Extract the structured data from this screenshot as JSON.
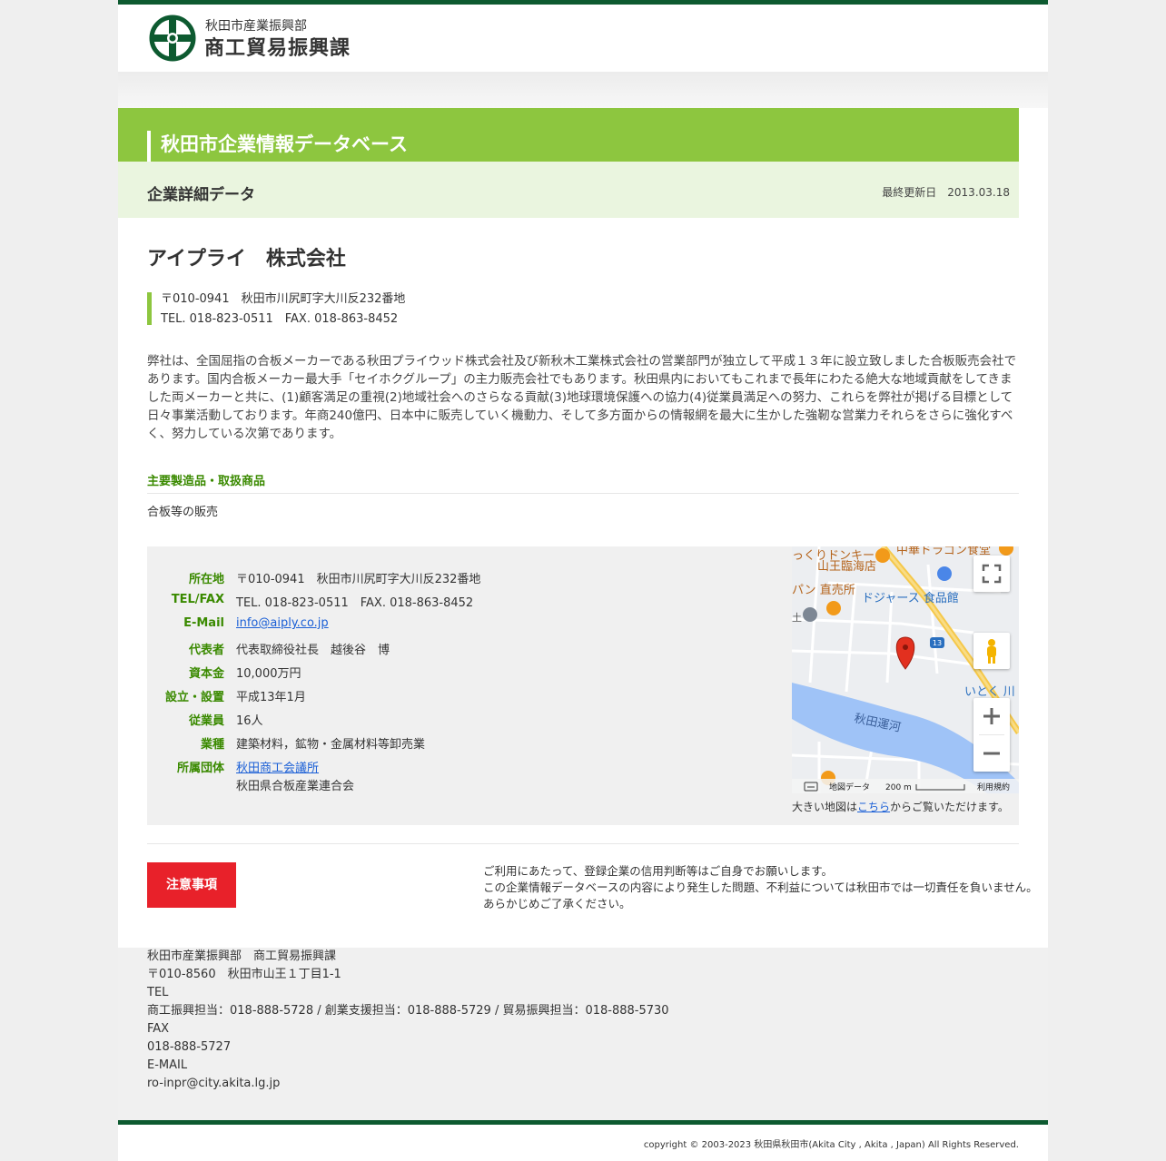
{
  "header": {
    "dept": "秋田市産業振興部",
    "section": "商工貿易振興課"
  },
  "db_title": "秋田市企業情報データベース",
  "subhead": {
    "title": "企業詳細データ",
    "updated_label": "最終更新日",
    "updated_date": "2013.03.18"
  },
  "company": {
    "name": "アイプライ　株式会社",
    "address": "〒010-0941　秋田市川尻町字大川反232番地",
    "telfax": "TEL. 018-823-0511　FAX. 018-863-8452",
    "description": "弊社は、全国屈指の合板メーカーである秋田プライウッド株式会社及び新秋木工業株式会社の営業部門が独立して平成１３年に設立致しました合板販売会社であります。国内合板メーカー最大手「セイホクグループ」の主力販売会社でもあります。秋田県内においてもこれまで長年にわたる絶大な地域貢献をしてきました両メーカーと共に、(1)顧客満足の重視(2)地域社会へのさらなる貢献(3)地球環境保護への協力(4)従業員満足への努力、これらを弊社が掲げる目標として日々事業活動しております。年商240億円、日本中に販売していく機動力、そして多方面からの情報網を最大に生かした強靭な営業力それらをさらに強化すべく、努力している次第であります。"
  },
  "products": {
    "heading": "主要製造品・取扱商品",
    "value": "合板等の販売"
  },
  "info": [
    {
      "label": "所在地",
      "value": "〒010-0941　秋田市川尻町字大川反232番地"
    },
    {
      "label": "TEL/FAX",
      "value": "TEL. 018-823-0511　FAX. 018-863-8452"
    },
    {
      "label": "E-Mail",
      "value": "info@aiply.co.jp"
    },
    {
      "label": "代表者",
      "value": "代表取締役社長　越後谷　博"
    },
    {
      "label": "資本金",
      "value": "10,000万円"
    },
    {
      "label": "設立・設置",
      "value": "平成13年1月"
    },
    {
      "label": "従業員",
      "value": "16人"
    },
    {
      "label": "業種",
      "value": "建築材料，鉱物・金属材料等卸売業"
    },
    {
      "label": "所属団体",
      "value": "秋田商工会議所",
      "value2": "秋田県合板産業連合会"
    }
  ],
  "map": {
    "labels": {
      "donkey": "っくりドンキー",
      "sanno": "山王臨海店",
      "dragon": "中華ドラゴン食堂",
      "pan": "パン 直売所",
      "dodgers": "ドジャース 食品館",
      "itoku": "いとく 川",
      "canal": "秋田運河",
      "route": "13",
      "tsuchi": "土"
    },
    "attribution": "地図データ",
    "scale": "200 m",
    "terms": "利用規約",
    "note_prefix": "大きい地図は",
    "note_link": "こちら",
    "note_suffix": "からご覧いただけます。"
  },
  "notice": {
    "button": "注意事項",
    "line1": "ご利用にあたって、登録企業の信用判断等はご自身でお願いします。",
    "line2": "この企業情報データベースの内容により発生した問題、不利益については秋田市では一切責任を負いません。",
    "line3": "あらかじめご了承ください。"
  },
  "footer": {
    "lines": [
      "秋田市産業振興部　商工貿易振興課",
      "〒010-8560　秋田市山王１丁目1-1",
      "TEL",
      "商工振興担当：018-888-5728 / 創業支援担当：018-888-5729 / 貿易振興担当：018-888-5730",
      "FAX",
      "018-888-5727",
      "E-MAIL",
      "ro-inpr@city.akita.lg.jp"
    ],
    "copyright": "copyright © 2003-2023 秋田県秋田市(Akita City , Akita , Japan) All Rights Reserved."
  },
  "colors": {
    "brand_green": "#0d5a30",
    "accent_green": "#8dc63f",
    "label_green": "#3a8a00",
    "notice_red": "#e8212a"
  }
}
